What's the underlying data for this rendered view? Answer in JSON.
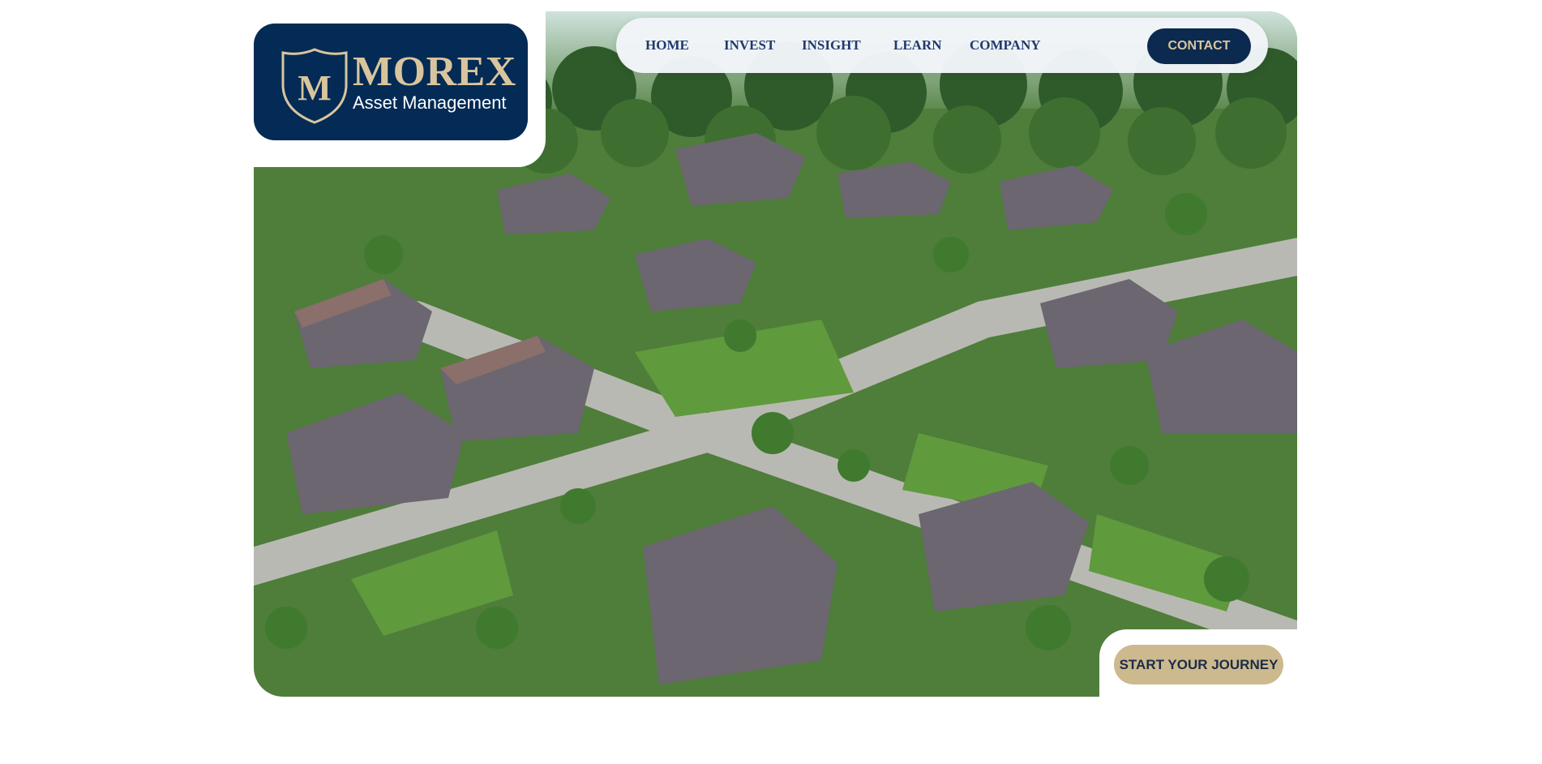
{
  "brand": {
    "logo_letter": "M",
    "name": "MOREX",
    "tagline": "Asset Management",
    "colors": {
      "navy": "#042b55",
      "gold": "#d9c59d",
      "nav_text": "#1f3a6e",
      "cta_gold": "#cdb98e"
    }
  },
  "nav": {
    "items": [
      {
        "label": "HOME"
      },
      {
        "label": "INVEST"
      },
      {
        "label": "INSIGHT"
      },
      {
        "label": "LEARN"
      },
      {
        "label": "COMPANY"
      }
    ],
    "contact_label": "CONTACT"
  },
  "hero": {
    "image_subject": "aerial-suburban-neighborhood",
    "cta_label": "START YOUR JOURNEY"
  }
}
